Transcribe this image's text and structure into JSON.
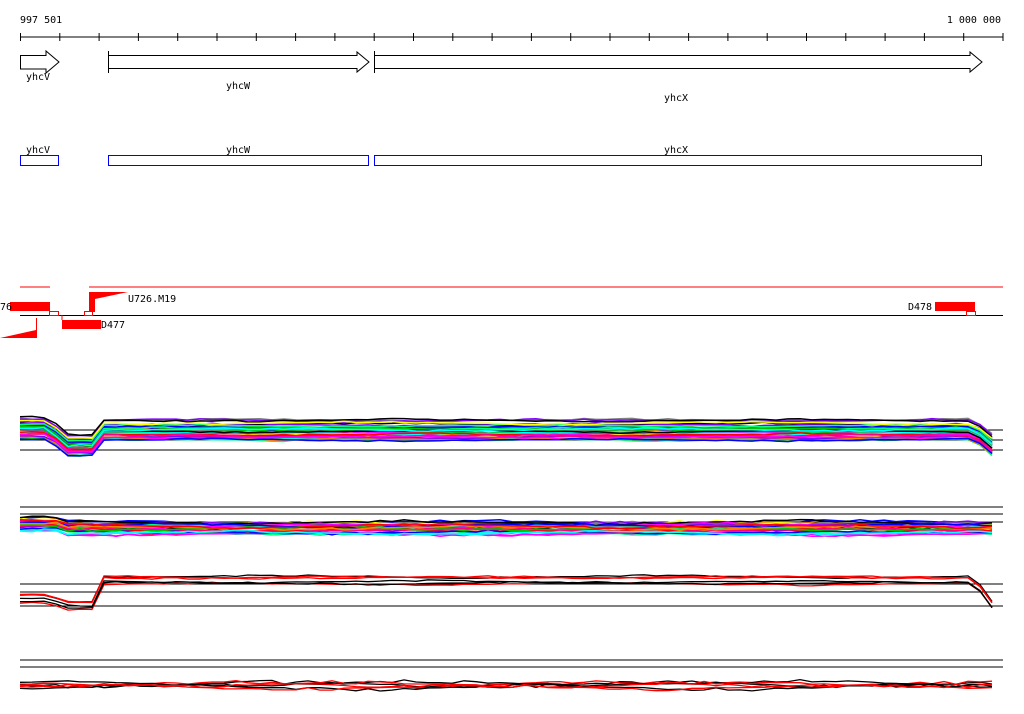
{
  "ruler": {
    "start_label": "997 501",
    "end_label": "1 000 000"
  },
  "genes": [
    {
      "name": "yhcV",
      "strand": "+"
    },
    {
      "name": "yhcW",
      "strand": "+"
    },
    {
      "name": "yhcX",
      "strand": "+"
    }
  ],
  "annotations": [
    {
      "name": "yhcV"
    },
    {
      "name": "yhcW"
    },
    {
      "name": "yhcX"
    }
  ],
  "features": {
    "left_partial": "76",
    "d477": "D477",
    "u726": "U726.M19",
    "d478": "D478"
  },
  "colors": {
    "feature": "#ff0000",
    "annotation_box": "#0000ff",
    "trace_palette": [
      "#ff00ff",
      "#00c000",
      "#00ffff",
      "#0000ff",
      "#ff8000",
      "#ff0000",
      "#ffff00",
      "#808080",
      "#8000ff",
      "#00ff80",
      "#ff0080",
      "#000000"
    ]
  }
}
